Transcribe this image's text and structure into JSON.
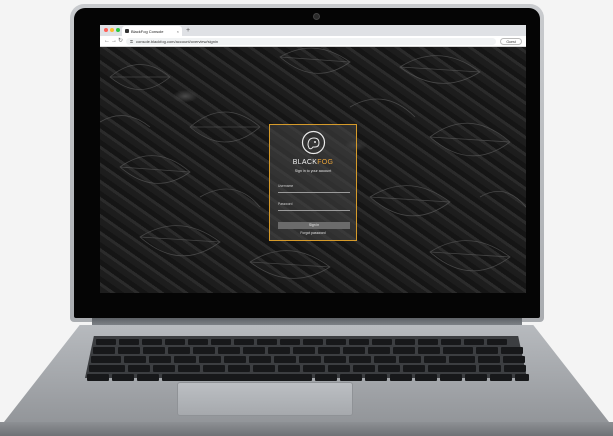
{
  "browser": {
    "tab_title": "BlackFog Console",
    "tab_close": "×",
    "new_tab": "+",
    "url": "console.blackfog.com/account/overview/signin",
    "guest_label": "Guest",
    "nav": {
      "back": "←",
      "forward": "→",
      "reload": "↻"
    }
  },
  "login": {
    "brand_black": "BLACK",
    "brand_fog": "FOG",
    "subtitle": "Sign in to your account",
    "username_label": "Username",
    "password_label": "Password",
    "signin_label": "Sign in",
    "forgot_label": "Forgot password"
  },
  "colors": {
    "accent": "#e8a33a",
    "card_border": "#d59a2a"
  }
}
